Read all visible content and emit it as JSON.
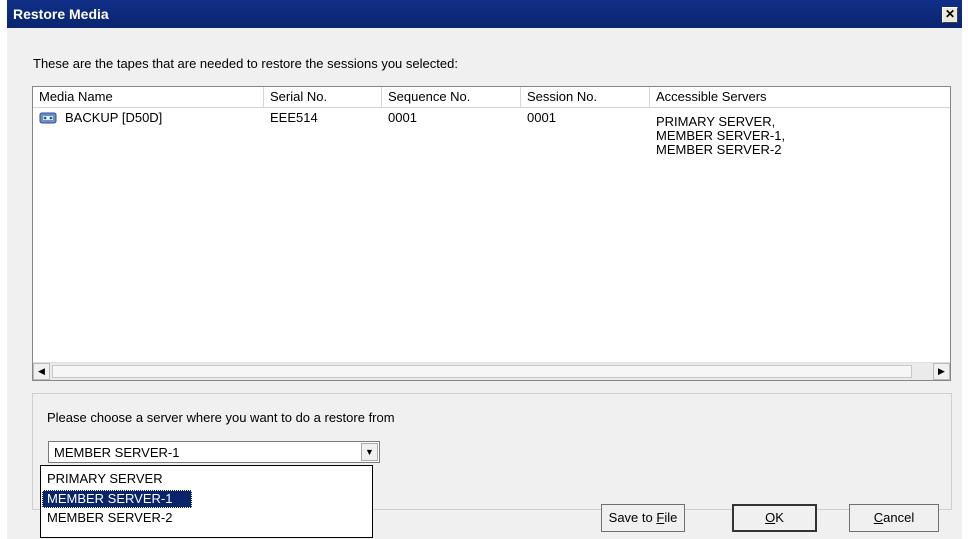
{
  "window": {
    "title": "Restore Media",
    "close_glyph": "✕"
  },
  "intro_text": "These are the tapes that are needed to restore the sessions you selected:",
  "table": {
    "columns": [
      "Media Name",
      "Serial No.",
      "Sequence No.",
      "Session No.",
      "Accessible Servers"
    ],
    "rows": [
      {
        "icon": "tape-icon",
        "media_name": "BACKUP [D50D]",
        "serial_no": "EEE514",
        "sequence_no": "0001",
        "session_no": "0001",
        "accessible_servers": [
          "PRIMARY SERVER,",
          "MEMBER SERVER-1,",
          "MEMBER SERVER-2"
        ]
      }
    ],
    "scroll_left_glyph": "◀",
    "scroll_right_glyph": "▶"
  },
  "server_group": {
    "label": "Please choose a server where you want to do a restore from",
    "selected": "MEMBER SERVER-1",
    "dropdown_glyph": "▼",
    "options": [
      "PRIMARY SERVER",
      "MEMBER SERVER-1",
      "MEMBER SERVER-2"
    ]
  },
  "buttons": {
    "save": {
      "prefix": "Save to ",
      "underlined": "F",
      "suffix": "ile"
    },
    "ok": {
      "prefix": "",
      "underlined": "O",
      "suffix": "K"
    },
    "cancel": {
      "prefix": "",
      "underlined": "C",
      "suffix": "ancel"
    }
  }
}
